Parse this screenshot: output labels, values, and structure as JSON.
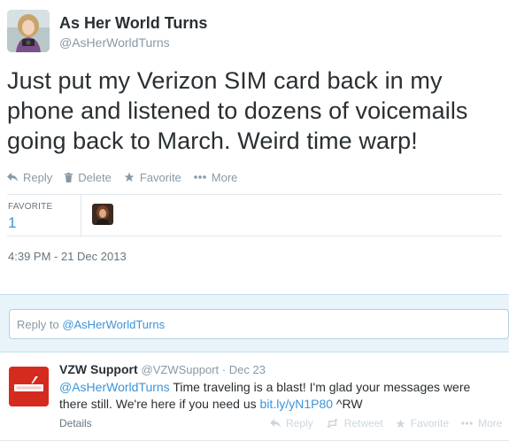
{
  "tweet": {
    "display_name": "As Her World Turns",
    "screen_name": "@AsHerWorldTurns",
    "text": "Just put my Verizon SIM card back in my phone and listened to dozens of voicemails going back to March. Weird time warp!",
    "actions": {
      "reply": "Reply",
      "delete": "Delete",
      "favorite": "Favorite",
      "more": "More"
    },
    "stats": {
      "favorite_label": "FAVORITE",
      "favorite_count": "1"
    },
    "timestamp": "4:39 PM - 21 Dec 2013"
  },
  "reply_box": {
    "prefix": "Reply to ",
    "mention": "@AsHerWorldTurns"
  },
  "reply_tweet": {
    "name": "VZW Support",
    "handle": "@VZWSupport",
    "separator": " · ",
    "date": "Dec 23",
    "mention": "@AsHerWorldTurns",
    "text": " Time traveling is a blast! I'm glad your messages were there still. We're here if you need us ",
    "link": "bit.ly/yN1P80",
    "signature": " ^RW",
    "details": "Details",
    "actions": {
      "reply": "Reply",
      "retweet": "Retweet",
      "favorite": "Favorite",
      "more": "More"
    },
    "avatar_brand": "verizon"
  },
  "colors": {
    "link": "#3b94d9",
    "verizon_red": "#d52b1e",
    "muted": "#8899a6"
  }
}
